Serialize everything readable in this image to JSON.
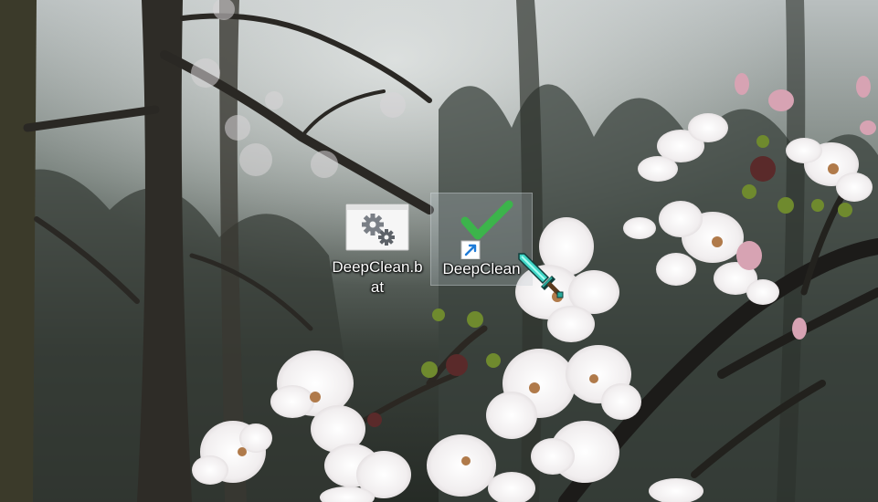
{
  "desktop": {
    "icons": [
      {
        "label": "DeepClean.bat",
        "icon": "batch-file-gears-icon",
        "selected": false
      },
      {
        "label": "DeepClean",
        "icon": "green-checkmark-shortcut-icon",
        "selected": true
      }
    ],
    "cursor": {
      "icon": "diamond-sword-cursor-icon"
    }
  },
  "colors": {
    "check_green": "#3cb44b",
    "shortcut_arrow": "#1e7bd8",
    "gear_gray": "#7a7f86",
    "sword_cyan": "#3fd6c6"
  }
}
